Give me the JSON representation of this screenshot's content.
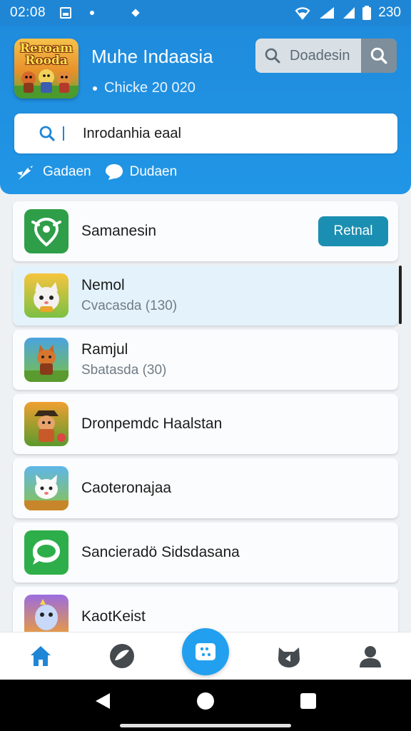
{
  "status_bar": {
    "time": "02:08",
    "battery": "230"
  },
  "header": {
    "logo_text": "Reroam Rooda",
    "title": "Muhe Indaasia",
    "subtitle": "Chicke 20 020",
    "top_search_placeholder": "Doadesin"
  },
  "search": {
    "value": "Inrodanhia eaal"
  },
  "filters": [
    {
      "label": "Gadaen",
      "icon": "rocket-icon"
    },
    {
      "label": "Dudaen",
      "icon": "chat-bubble-icon"
    }
  ],
  "list": [
    {
      "name": "Samanesin",
      "sub": "",
      "icon": "target-app-icon",
      "color": "#2e9e48",
      "button": "Retnal"
    },
    {
      "name": "Nemol",
      "sub": "Cvacasda (130)",
      "icon": "cat-game-icon",
      "color": "#7bc043",
      "selected": true
    },
    {
      "name": "Ramjul",
      "sub": "Sbatasda (30)",
      "icon": "fox-game-icon",
      "color": "#4aa3df"
    },
    {
      "name": "Dronpemdc Haalstan",
      "sub": "",
      "icon": "pirate-game-icon",
      "color": "#f0a030"
    },
    {
      "name": "Caoteronajaa",
      "sub": "",
      "icon": "bunny-game-icon",
      "color": "#5fb6e8"
    },
    {
      "name": "Sancieradö Sidsdasana",
      "sub": "",
      "icon": "message-app-icon",
      "color": "#2eae4a"
    },
    {
      "name": "KaotKeist",
      "sub": "",
      "icon": "monster-game-icon",
      "color": "#9b6ce0"
    }
  ],
  "bottom_nav": [
    {
      "name": "home-icon"
    },
    {
      "name": "explore-icon"
    },
    {
      "name": "games-icon"
    },
    {
      "name": "cat-icon"
    },
    {
      "name": "profile-icon"
    }
  ],
  "colors": {
    "primary": "#1f86d6",
    "accent": "#22a0ef",
    "retry_button": "#1b8fb1"
  }
}
